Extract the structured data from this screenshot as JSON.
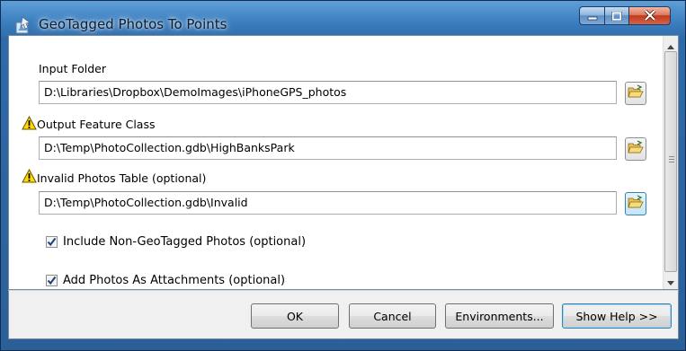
{
  "window": {
    "title": "GeoTagged Photos To Points",
    "colors": {
      "frame": "#3c7fc0",
      "close": "#c23b1c",
      "client": "#ffffff"
    }
  },
  "params": {
    "input_folder": {
      "label": "Input Folder",
      "value": "D:\\Libraries\\Dropbox\\DemoImages\\iPhoneGPS_photos"
    },
    "output_feature_class": {
      "label": "Output Feature Class",
      "value": "D:\\Temp\\PhotoCollection.gdb\\HighBanksPark",
      "warning": true
    },
    "invalid_photos_table": {
      "label": "Invalid Photos Table (optional)",
      "value": "D:\\Temp\\PhotoCollection.gdb\\Invalid",
      "warning": true
    },
    "include_non_geotagged": {
      "label": "Include Non-GeoTagged Photos (optional)",
      "checked": true
    },
    "add_photos_as_attachments": {
      "label": "Add Photos As Attachments (optional)",
      "checked": true
    }
  },
  "buttons": {
    "ok": "OK",
    "cancel": "Cancel",
    "environments": "Environments...",
    "show_help": "Show Help >>"
  },
  "icons": [
    "app-icon",
    "minimize-icon",
    "maximize-icon",
    "close-icon",
    "warning-icon",
    "folder-browse-icon",
    "checkmark-icon",
    "scroll-up-icon",
    "scroll-down-icon"
  ]
}
